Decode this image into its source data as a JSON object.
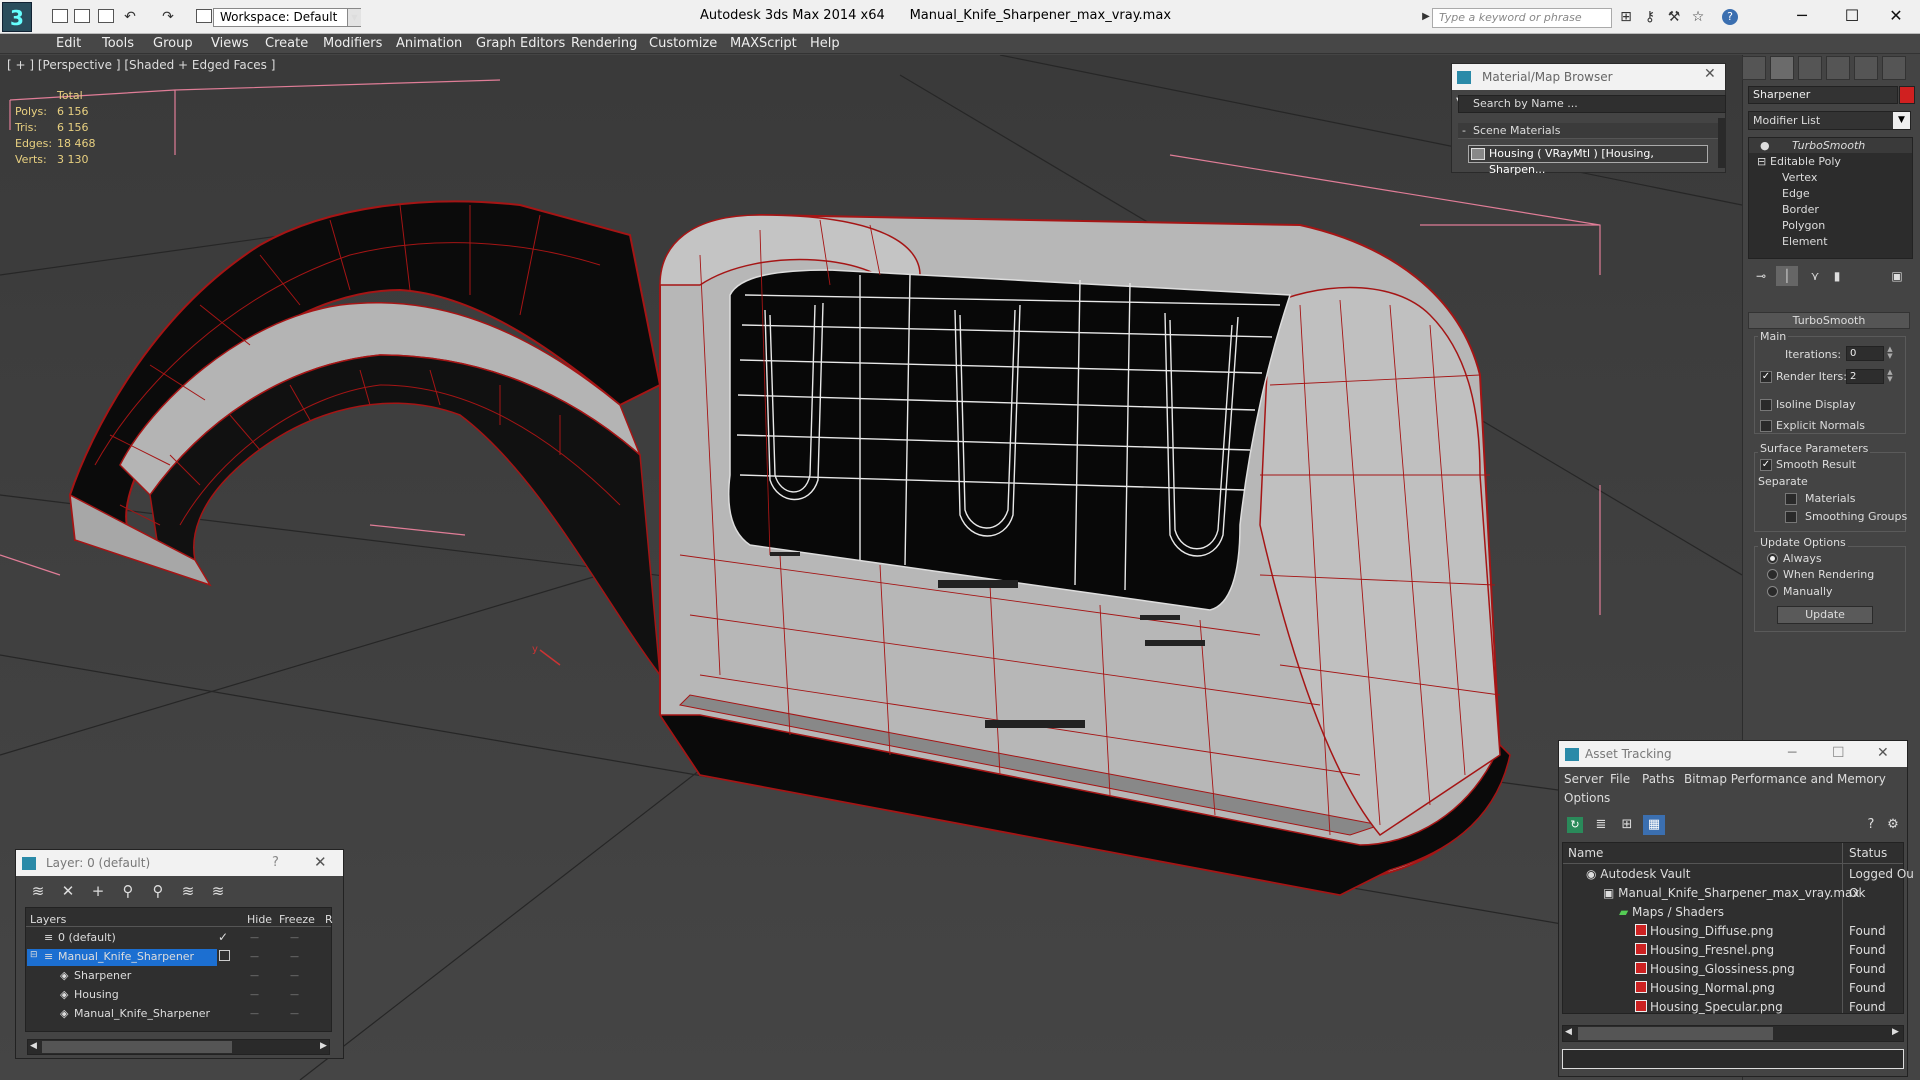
{
  "titlebar": {
    "workspace": "Workspace: Default",
    "app": "Autodesk 3ds Max  2014 x64",
    "file": "Manual_Knife_Sharpener_max_vray.max",
    "search_placeholder": "Type a keyword or phrase"
  },
  "menu": [
    "Edit",
    "Tools",
    "Group",
    "Views",
    "Create",
    "Modifiers",
    "Animation",
    "Graph Editors",
    "Rendering",
    "Customize",
    "MAXScript",
    "Help"
  ],
  "viewport": {
    "label": "[ + ] [Perspective ] [Shaded + Edged Faces ]",
    "stats": {
      "header": "Total",
      "rows": [
        {
          "label": "Polys:",
          "value": "6 156"
        },
        {
          "label": "Tris:",
          "value": "6 156"
        },
        {
          "label": "Edges:",
          "value": "18 468"
        },
        {
          "label": "Verts:",
          "value": "3 130"
        }
      ]
    }
  },
  "command_panel": {
    "object_name": "Sharpener",
    "object_color": "#d02020",
    "modifier_list": "Modifier List",
    "stack": [
      "TurboSmooth",
      "Editable Poly",
      "Vertex",
      "Edge",
      "Border",
      "Polygon",
      "Element"
    ],
    "rollout": {
      "title": "TurboSmooth",
      "main": "Main",
      "iterations_label": "Iterations:",
      "iterations": "0",
      "render_iters_label": "Render Iters:",
      "render_iters": "2",
      "isoline": "Isoline Display",
      "explicit": "Explicit Normals",
      "surface": "Surface Parameters",
      "smooth_result": "Smooth Result",
      "separate": "Separate",
      "materials": "Materials",
      "smoothing_groups": "Smoothing Groups",
      "update_options": "Update Options",
      "always": "Always",
      "when_rendering": "When Rendering",
      "manually": "Manually",
      "update": "Update"
    }
  },
  "material_browser": {
    "title": "Material/Map Browser",
    "search": "Search by Name ...",
    "section": "Scene Materials",
    "item": "Housing  ( VRayMtl ) [Housing, Sharpen..."
  },
  "layer_window": {
    "title": "Layer: 0 (default)",
    "help": "?",
    "columns": [
      "Layers",
      "Hide",
      "Freeze",
      "R"
    ],
    "rows": [
      "0 (default)",
      "Manual_Knife_Sharpener",
      "Sharpener",
      "Housing",
      "Manual_Knife_Sharpener"
    ]
  },
  "asset_tracking": {
    "title": "Asset Tracking",
    "menu": [
      "Server",
      "File",
      "Paths",
      "Bitmap Performance and Memory",
      "Options"
    ],
    "columns": [
      "Name",
      "Status"
    ],
    "rows": [
      {
        "name": "Autodesk Vault",
        "status": "Logged Ou"
      },
      {
        "name": "Manual_Knife_Sharpener_max_vray.max",
        "status": "Ok"
      },
      {
        "name": "Maps / Shaders",
        "status": ""
      },
      {
        "name": "Housing_Diffuse.png",
        "status": "Found"
      },
      {
        "name": "Housing_Fresnel.png",
        "status": "Found"
      },
      {
        "name": "Housing_Glossiness.png",
        "status": "Found"
      },
      {
        "name": "Housing_Normal.png",
        "status": "Found"
      },
      {
        "name": "Housing_Specular.png",
        "status": "Found"
      }
    ]
  }
}
